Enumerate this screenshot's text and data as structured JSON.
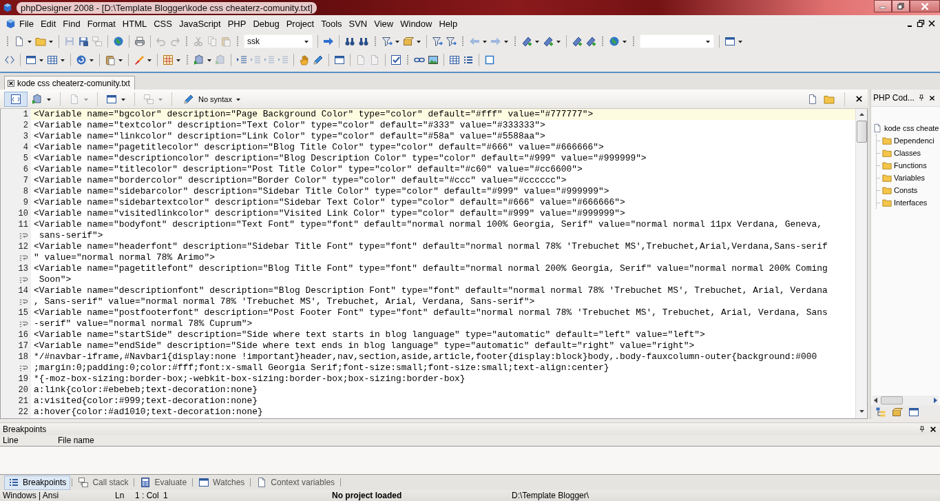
{
  "window": {
    "title": "phpDesigner 2008 - [D:\\Template Blogger\\kode css cheaterz-comunity.txt]"
  },
  "menu": [
    "File",
    "Edit",
    "Find",
    "Format",
    "HTML",
    "CSS",
    "JavaScript",
    "PHP",
    "Debug",
    "Project",
    "Tools",
    "SVN",
    "View",
    "Window",
    "Help"
  ],
  "toolbar": {
    "find_combo": {
      "value": "ssk"
    }
  },
  "document_tabs": [
    {
      "label": "kode css cheaterz-comunity.txt",
      "selected": true
    }
  ],
  "editor_toolbar": {
    "syntax_button": "No syntax"
  },
  "editor": {
    "lines": [
      {
        "number": "1",
        "text": "<Variable name=\"bgcolor\" description=\"Page Background Color\" type=\"color\" default=\"#fff\" value=\"#777777\">",
        "current": true
      },
      {
        "number": "2",
        "text": "<Variable name=\"textcolor\" description=\"Text Color\" type=\"color\" default=\"#333\" value=\"#333333\">",
        "current": false
      },
      {
        "number": "3",
        "text": "<Variable name=\"linkcolor\" description=\"Link Color\" type=\"color\" default=\"#58a\" value=\"#5588aa\">",
        "current": false
      },
      {
        "number": "4",
        "text": "<Variable name=\"pagetitlecolor\" description=\"Blog Title Color\" type=\"color\" default=\"#666\" value=\"#666666\">",
        "current": false
      },
      {
        "number": "5",
        "text": "<Variable name=\"descriptioncolor\" description=\"Blog Description Color\" type=\"color\" default=\"#999\" value=\"#999999\">",
        "current": false
      },
      {
        "number": "6",
        "text": "<Variable name=\"titlecolor\" description=\"Post Title Color\" type=\"color\" default=\"#c60\" value=\"#cc6600\">",
        "current": false
      },
      {
        "number": "7",
        "text": "<Variable name=\"bordercolor\" description=\"Border Color\" type=\"color\" default=\"#ccc\" value=\"#cccccc\">",
        "current": false
      },
      {
        "number": "8",
        "text": "<Variable name=\"sidebarcolor\" description=\"Sidebar Title Color\" type=\"color\" default=\"#999\" value=\"#999999\">",
        "current": false
      },
      {
        "number": "9",
        "text": "<Variable name=\"sidebartextcolor\" description=\"Sidebar Text Color\" type=\"color\" default=\"#666\" value=\"#666666\">",
        "current": false
      },
      {
        "number": "10",
        "text": "<Variable name=\"visitedlinkcolor\" description=\"Visited Link Color\" type=\"color\" default=\"#999\" value=\"#999999\">",
        "current": false
      },
      {
        "number": "11",
        "text": "<Variable name=\"bodyfont\" description=\"Text Font\" type=\"font\" default=\"normal normal 100% Georgia, Serif\" value=\"normal normal 11px Verdana, Geneva,",
        "wrapped": [
          " sans-serif\">"
        ],
        "current": false
      },
      {
        "number": "12",
        "text": "<Variable name=\"headerfont\" description=\"Sidebar Title Font\" type=\"font\" default=\"normal normal 78% 'Trebuchet MS',Trebuchet,Arial,Verdana,Sans-serif",
        "wrapped": [
          "\" value=\"normal normal 78% Arimo\">"
        ],
        "current": false
      },
      {
        "number": "13",
        "text": "<Variable name=\"pagetitlefont\" description=\"Blog Title Font\" type=\"font\" default=\"normal normal 200% Georgia, Serif\" value=\"normal normal 200% Coming",
        "wrapped": [
          " Soon\">"
        ],
        "current": false
      },
      {
        "number": "14",
        "text": "<Variable name=\"descriptionfont\" description=\"Blog Description Font\" type=\"font\" default=\"normal normal 78% 'Trebuchet MS', Trebuchet, Arial, Verdana",
        "wrapped": [
          ", Sans-serif\" value=\"normal normal 78% 'Trebuchet MS', Trebuchet, Arial, Verdana, Sans-serif\">"
        ],
        "current": false
      },
      {
        "number": "15",
        "text": "<Variable name=\"postfooterfont\" description=\"Post Footer Font\" type=\"font\" default=\"normal normal 78% 'Trebuchet MS', Trebuchet, Arial, Verdana, Sans",
        "wrapped": [
          "-serif\" value=\"normal normal 78% Cuprum\">"
        ],
        "current": false
      },
      {
        "number": "16",
        "text": "<Variable name=\"startSide\" description=\"Side where text starts in blog language\" type=\"automatic\" default=\"left\" value=\"left\">",
        "current": false
      },
      {
        "number": "17",
        "text": "<Variable name=\"endSide\" description=\"Side where text ends in blog language\" type=\"automatic\" default=\"right\" value=\"right\">",
        "current": false
      },
      {
        "number": "18",
        "text": "*/#navbar-iframe,#Navbar1{display:none !important}header,nav,section,aside,article,footer{display:block}body,.body-fauxcolumn-outer{background:#000",
        "wrapped": [
          ";margin:0;padding:0;color:#fff;font:x-small Georgia Serif;font-size:small;font-size:small;text-align:center}"
        ],
        "current": false
      },
      {
        "number": "19",
        "text": "*{-moz-box-sizing:border-box;-webkit-box-sizing:border-box;box-sizing:border-box}",
        "current": false
      },
      {
        "number": "20",
        "text": "a:link{color:#ebebeb;text-decoration:none}",
        "current": false
      },
      {
        "number": "21",
        "text": "a:visited{color:#999;text-decoration:none}",
        "current": false
      },
      {
        "number": "22",
        "text": "a:hover{color:#ad1010;text-decoration:none}",
        "current": false
      }
    ]
  },
  "code_explorer": {
    "title": "PHP Cod...",
    "tree": [
      {
        "label": "kode css cheate",
        "children": [
          {
            "label": "Dependenci"
          },
          {
            "label": "Classes"
          },
          {
            "label": "Functions"
          },
          {
            "label": "Variables"
          },
          {
            "label": "Consts"
          },
          {
            "label": "Interfaces"
          }
        ]
      }
    ]
  },
  "breakpoints": {
    "title": "Breakpoints",
    "columns": [
      "Line",
      "File name"
    ]
  },
  "bottom_tabs": [
    {
      "label": "Breakpoints",
      "selected": true
    },
    {
      "label": "Call stack",
      "selected": false
    },
    {
      "label": "Evaluate",
      "selected": false
    },
    {
      "label": "Watches",
      "selected": false
    },
    {
      "label": "Context variables",
      "selected": false
    }
  ],
  "status_bar": {
    "encoding": "Windows | Ansi",
    "ln_label": "Ln",
    "position": "1 : Col",
    "column": "1",
    "project": "No project loaded",
    "path": "D:\\Template Blogger\\"
  }
}
